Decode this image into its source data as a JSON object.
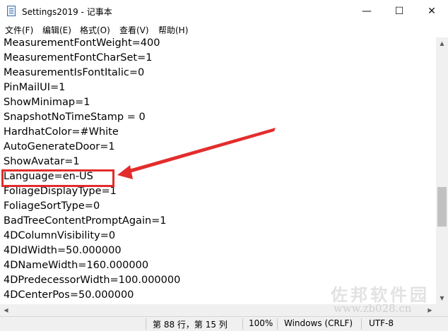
{
  "window": {
    "title": "Settings2019 - 记事本",
    "controls": {
      "minimize": "—",
      "maximize": "☐",
      "close": "✕"
    }
  },
  "menu": [
    "文件(F)",
    "编辑(E)",
    "格式(O)",
    "查看(V)",
    "帮助(H)"
  ],
  "editor": {
    "lines": [
      "MeasurementFontWeight=400",
      "MeasurementFontCharSet=1",
      "MeasurementIsFontItalic=0",
      "PinMailUI=1",
      "ShowMinimap=1",
      "SnapshotNoTimeStamp = 0",
      "HardhatColor=#White",
      "AutoGenerateDoor=1",
      "ShowAvatar=1",
      "Language=en-US",
      "FoliageDisplayType=1",
      "FoliageSortType=0",
      "BadTreeContentPromptAgain=1",
      "4DColumnVisibility=0",
      "4DIdWidth=50.000000",
      "4DNameWidth=160.000000",
      "4DPredecessorWidth=100.000000",
      "4DCenterPos=50.000000"
    ],
    "highlighted_line": "Language=en-US",
    "annotation_color": "#e32c2c"
  },
  "statusbar": {
    "position": "第 88 行，第 15 列",
    "zoom": "100%",
    "line_ending": "Windows (CRLF)",
    "encoding": "UTF-8"
  },
  "watermark": {
    "brand": "佐邦软件园",
    "url": "www.zb028.cn"
  }
}
